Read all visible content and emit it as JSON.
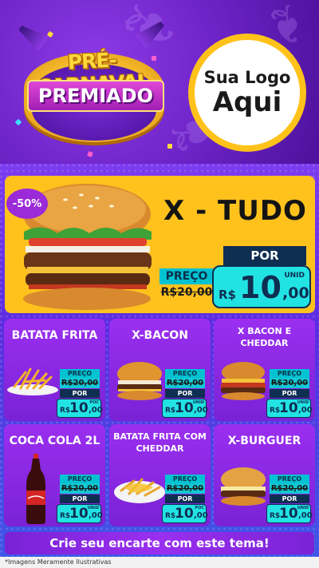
{
  "header": {
    "title_top": "PRÉ-CARNAVAL",
    "title_bottom": "PREMIADO",
    "logo_line1": "Sua Logo",
    "logo_line2": "Aqui"
  },
  "hero": {
    "discount": "-50%",
    "name": "X - TUDO",
    "preco_label": "PREÇO",
    "old_price": "R$20,00",
    "por_label": "POR",
    "currency": "R$",
    "price_main": "10",
    "price_cents": ",00",
    "unit": "UNID"
  },
  "products": [
    {
      "name": "BATATA FRITA",
      "preco_label": "PREÇO",
      "old_price": "R$20,00",
      "por_label": "POR",
      "currency": "R$",
      "price_main": "10",
      "price_cents": ",00",
      "unit": "POC"
    },
    {
      "name": "X-BACON",
      "preco_label": "PREÇO",
      "old_price": "R$20,00",
      "por_label": "POR",
      "currency": "R$",
      "price_main": "10",
      "price_cents": ",00",
      "unit": "UNID"
    },
    {
      "name": "X BACON E CHEDDAR",
      "preco_label": "PREÇO",
      "old_price": "R$20,00",
      "por_label": "POR",
      "currency": "R$",
      "price_main": "10",
      "price_cents": ",00",
      "unit": "UNID"
    },
    {
      "name": "COCA COLA 2L",
      "preco_label": "PREÇO",
      "old_price": "R$20,00",
      "por_label": "POR",
      "currency": "R$",
      "price_main": "10",
      "price_cents": ",00",
      "unit": "UNID"
    },
    {
      "name": "BATATA FRITA COM CHEDDAR",
      "preco_label": "PREÇO",
      "old_price": "R$20,00",
      "por_label": "POR",
      "currency": "R$",
      "price_main": "10",
      "price_cents": ",00",
      "unit": "POC"
    },
    {
      "name": "X-BURGUER",
      "preco_label": "PREÇO",
      "old_price": "R$20,00",
      "por_label": "POR",
      "currency": "R$",
      "price_main": "10",
      "price_cents": ",00",
      "unit": "UNID"
    }
  ],
  "cta": "Crie seu encarte com este tema!",
  "disclaimer": "*Imagens Meramente Ilustrativas",
  "colors": {
    "purple": "#7a22d6",
    "yellow": "#ffc21d",
    "cyan": "#22e3e3",
    "navy": "#0e2e52"
  },
  "icons": [
    "burger-image",
    "fries-image",
    "soda-bottle-image",
    "cheese-fries-image",
    "party-horn-icon",
    "palm-leaf-icon"
  ]
}
